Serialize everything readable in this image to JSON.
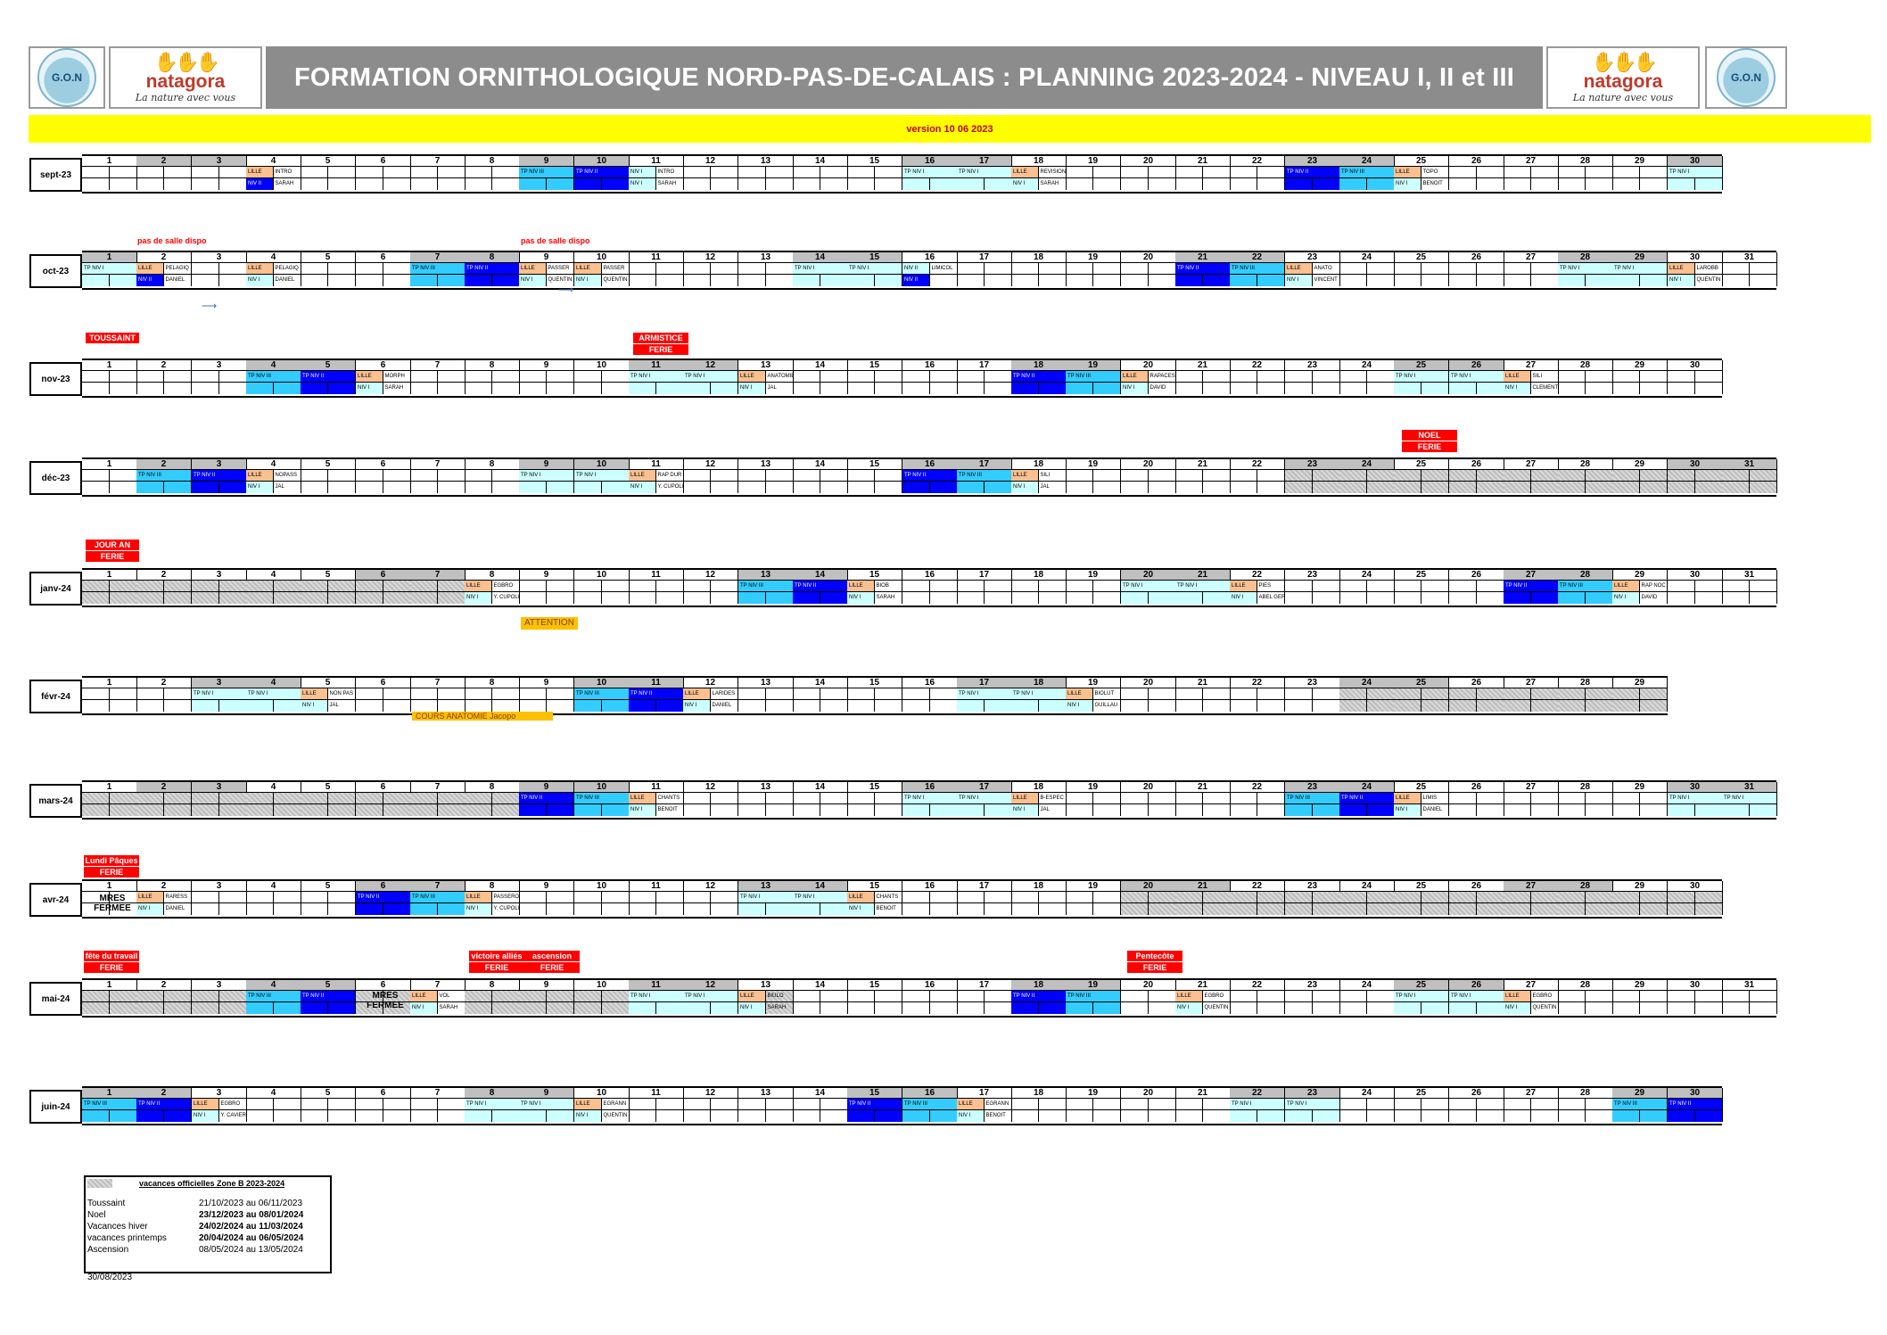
{
  "header": {
    "title": "FORMATION ORNITHOLOGIQUE NORD-PAS-DE-CALAIS : PLANNING 2023-2024 - NIVEAU I, II et III",
    "version": "version 10 06 2023",
    "logo_gon": "G.O.N",
    "logo_natagora": "natagora",
    "logo_tagline": "La nature avec vous"
  },
  "colors": {
    "tp_niv_1": "#ccffff",
    "tp_niv_2": "#0000ff",
    "tp_niv_3": "#33ccff",
    "lille": "#fac090",
    "ferie": "#ff0000",
    "version_bar": "#ffff00"
  },
  "months": [
    {
      "label": "sept-23",
      "days": 30,
      "weekends": [
        2,
        3,
        9,
        10,
        16,
        17,
        23,
        24,
        30
      ]
    },
    {
      "label": "oct-23",
      "days": 31,
      "weekends": [
        1,
        7,
        8,
        14,
        15,
        21,
        22,
        28,
        29
      ]
    },
    {
      "label": "nov-23",
      "days": 30,
      "weekends": [
        4,
        5,
        11,
        12,
        18,
        19,
        25,
        26
      ]
    },
    {
      "label": "déc-23",
      "days": 31,
      "weekends": [
        2,
        3,
        9,
        10,
        16,
        17,
        23,
        24,
        30,
        31
      ]
    },
    {
      "label": "janv-24",
      "days": 31,
      "weekends": [
        6,
        7,
        13,
        14,
        20,
        21,
        27,
        28
      ]
    },
    {
      "label": "févr-24",
      "days": 29,
      "weekends": [
        3,
        4,
        10,
        11,
        17,
        18,
        24,
        25
      ]
    },
    {
      "label": "mars-24",
      "days": 31,
      "weekends": [
        2,
        3,
        9,
        10,
        16,
        17,
        23,
        24,
        30,
        31
      ]
    },
    {
      "label": "avr-24",
      "days": 30,
      "weekends": [
        6,
        7,
        13,
        14,
        20,
        21,
        27,
        28
      ]
    },
    {
      "label": "mai-24",
      "days": 31,
      "weekends": [
        4,
        5,
        11,
        12,
        18,
        19,
        25,
        26
      ]
    },
    {
      "label": "juin-24",
      "days": 30,
      "weekends": [
        1,
        2,
        8,
        9,
        15,
        16,
        22,
        23,
        29,
        30
      ]
    }
  ],
  "texts": {
    "tp1": "TP NIV I",
    "tp2": "TP NIV II",
    "tp3": "TP NIV III",
    "lille": "LILLE",
    "niv1": "NIV I",
    "niv2": "NIV II",
    "ferie": "FERIE",
    "toussaint": "TOUSSAINT",
    "armistice": "ARMISTICE",
    "noel": "NOEL",
    "jour_an": "JOUR AN",
    "lundi_paques": "Lundi Pâques",
    "fete_travail": "fête du travail",
    "victoire": "victoire alliés",
    "ascension": "ascension",
    "pentecote": "Pentecôte",
    "pas_de_salle": "pas de salle dispo",
    "attention": "ATTENTION",
    "cours_anatomie": "COURS ANATOMIE Jacopo",
    "mres_fermee_1": "MRES",
    "mres_fermee_2": "FERMEE"
  },
  "legend": {
    "title": "vacances officielles  Zone B 2023-2024",
    "rows": [
      {
        "name": "Toussaint",
        "dates": "21/10/2023 au 06/11/2023"
      },
      {
        "name": "Noel",
        "dates": "23/12/2023 au 08/01/2024"
      },
      {
        "name": "Vacances hiver",
        "dates": "24/02/2024 au 11/03/2024"
      },
      {
        "name": "vacances printemps",
        "dates": "20/04/2024 au 06/05/2024"
      },
      {
        "name": "Ascension",
        "dates": "08/05/2024 au 13/05/2024"
      }
    ],
    "footer_date": "30/08/2023"
  },
  "sessions": [
    {
      "m": 0,
      "d": 4,
      "a": "LILLE",
      "b": "INTRO",
      "c": "NIV II",
      "e": "SARAH"
    },
    {
      "m": 0,
      "d": 11,
      "a": "NIV I",
      "b": "INTRO",
      "c": "NIV I",
      "e": "SARAH"
    },
    {
      "m": 0,
      "d": 18,
      "a": "LILLE",
      "b": "REVISION",
      "c": "NIV I",
      "e": "SARAH"
    },
    {
      "m": 0,
      "d": 25,
      "a": "LILLE",
      "b": "TOPO",
      "c": "NIV I",
      "e": "BENOIT"
    },
    {
      "m": 1,
      "d": 2,
      "a": "LILLE",
      "b": "PELAGIQ",
      "c": "NIV II",
      "e": "DANIEL"
    },
    {
      "m": 1,
      "d": 4,
      "a": "LILLE",
      "b": "PELAGIQ",
      "c": "NIV I",
      "e": "DANIEL"
    },
    {
      "m": 1,
      "d": 9,
      "a": "LILLE",
      "b": "PASSER",
      "c": "NIV I",
      "e": "QUENTIN"
    },
    {
      "m": 1,
      "d": 10,
      "a": "LILLE",
      "b": "PASSER",
      "c": "NIV I",
      "e": "QUENTIN"
    },
    {
      "m": 1,
      "d": 16,
      "a": "NIV II",
      "b": "LIMICOL",
      "c": "NIV II",
      "e": ""
    },
    {
      "m": 1,
      "d": 23,
      "a": "LILLE",
      "b": "ANATO",
      "c": "NIV I",
      "e": "VINCENT"
    },
    {
      "m": 1,
      "d": 30,
      "a": "LILLE",
      "b": "LAROBB",
      "c": "NIV I",
      "e": "QUENTIN"
    },
    {
      "m": 2,
      "d": 6,
      "a": "LILLE",
      "b": "MORPH",
      "c": "NIV I",
      "e": "SARAH"
    },
    {
      "m": 2,
      "d": 13,
      "a": "LILLE",
      "b": "ANATOMIE",
      "c": "NIV I",
      "e": "JAL"
    },
    {
      "m": 2,
      "d": 20,
      "a": "LILLE",
      "b": "RAPACES",
      "c": "NIV I",
      "e": "DAVID"
    },
    {
      "m": 2,
      "d": 27,
      "a": "LILLE",
      "b": "SILI",
      "c": "NIV I",
      "e": "CLEMENT"
    },
    {
      "m": 3,
      "d": 4,
      "a": "LILLE",
      "b": "NOPASS",
      "c": "NIV I",
      "e": "JAL"
    },
    {
      "m": 3,
      "d": 11,
      "a": "LILLE",
      "b": "RAP DUR",
      "c": "NIV I",
      "e": "Y. CUPOLI"
    },
    {
      "m": 3,
      "d": 18,
      "a": "LILLE",
      "b": "SILI",
      "c": "NIV I",
      "e": "JAL"
    },
    {
      "m": 4,
      "d": 8,
      "a": "LILLE",
      "b": "EGBRO",
      "c": "NIV I",
      "e": "Y. CUPOLI"
    },
    {
      "m": 4,
      "d": 15,
      "a": "LILLE",
      "b": "BIOB",
      "c": "NIV I",
      "e": "SARAH"
    },
    {
      "m": 4,
      "d": 22,
      "a": "LILLE",
      "b": "PIES",
      "c": "NIV I",
      "e": "ABEL GERARD"
    },
    {
      "m": 4,
      "d": 29,
      "a": "LILLE",
      "b": "RAP NOC",
      "c": "NIV I",
      "e": "DAVID"
    },
    {
      "m": 5,
      "d": 5,
      "a": "LILLE",
      "b": "NON PAS",
      "c": "NIV I",
      "e": "JAL"
    },
    {
      "m": 5,
      "d": 12,
      "a": "LILLE",
      "b": "LARIDES",
      "c": "NIV I",
      "e": "DANIEL"
    },
    {
      "m": 5,
      "d": 19,
      "a": "LILLE",
      "b": "BIOLUT",
      "c": "NIV I",
      "e": "GUILLAU"
    },
    {
      "m": 6,
      "d": 11,
      "a": "LILLE",
      "b": "CHANTS",
      "c": "NIV I",
      "e": "BENOIT"
    },
    {
      "m": 6,
      "d": 18,
      "a": "LILLE",
      "b": "B-ESPEC",
      "c": "NIV I",
      "e": "JAL"
    },
    {
      "m": 6,
      "d": 25,
      "a": "LILLE",
      "b": "LIMIS",
      "c": "NIV I",
      "e": "DANIEL"
    },
    {
      "m": 7,
      "d": 2,
      "a": "LILLE",
      "b": "RARESS",
      "c": "NIV I",
      "e": "DANIEL"
    },
    {
      "m": 7,
      "d": 8,
      "a": "LILLE",
      "b": "PASSERO",
      "c": "NIV I",
      "e": "Y. CUPOLI"
    },
    {
      "m": 7,
      "d": 15,
      "a": "LILLE",
      "b": "CHANTS",
      "c": "NIV I",
      "e": "BENOIT"
    },
    {
      "m": 8,
      "d": 7,
      "a": "LILLE",
      "b": "VOL",
      "c": "NIV I",
      "e": "SARAH"
    },
    {
      "m": 8,
      "d": 13,
      "a": "LILLE",
      "b": "BIULO",
      "c": "NIV I",
      "e": "SARAH"
    },
    {
      "m": 8,
      "d": 21,
      "a": "LILLE",
      "b": "EGBRO",
      "c": "NIV I",
      "e": "QUENTIN"
    },
    {
      "m": 8,
      "d": 27,
      "a": "LILLE",
      "b": "EGBRO",
      "c": "NIV I",
      "e": "QUENTIN"
    },
    {
      "m": 9,
      "d": 3,
      "a": "LILLE",
      "b": "EGBRO",
      "c": "NIV I",
      "e": "Y. CAVIER"
    },
    {
      "m": 9,
      "d": 10,
      "a": "LILLE",
      "b": "EGRANN",
      "c": "NIV I",
      "e": "QUENTIN"
    },
    {
      "m": 9,
      "d": 17,
      "a": "LILLE",
      "b": "EGRANN",
      "c": "NIV I",
      "e": "BENOIT"
    }
  ],
  "tp": [
    {
      "m": 0,
      "d": 9,
      "t": "tp3"
    },
    {
      "m": 0,
      "d": 10,
      "t": "tp2"
    },
    {
      "m": 0,
      "d": 16,
      "t": "tp1"
    },
    {
      "m": 0,
      "d": 17,
      "t": "tp1"
    },
    {
      "m": 0,
      "d": 23,
      "t": "tp2"
    },
    {
      "m": 0,
      "d": 24,
      "t": "tp3"
    },
    {
      "m": 0,
      "d": 30,
      "t": "tp1"
    },
    {
      "m": 1,
      "d": 1,
      "t": "tp1"
    },
    {
      "m": 1,
      "d": 7,
      "t": "tp3"
    },
    {
      "m": 1,
      "d": 8,
      "t": "tp2"
    },
    {
      "m": 1,
      "d": 14,
      "t": "tp1"
    },
    {
      "m": 1,
      "d": 15,
      "t": "tp1"
    },
    {
      "m": 1,
      "d": 21,
      "t": "tp2"
    },
    {
      "m": 1,
      "d": 22,
      "t": "tp3"
    },
    {
      "m": 1,
      "d": 28,
      "t": "tp1"
    },
    {
      "m": 1,
      "d": 29,
      "t": "tp1"
    },
    {
      "m": 2,
      "d": 4,
      "t": "tp3"
    },
    {
      "m": 2,
      "d": 5,
      "t": "tp2"
    },
    {
      "m": 2,
      "d": 11,
      "t": "tp1"
    },
    {
      "m": 2,
      "d": 12,
      "t": "tp1"
    },
    {
      "m": 2,
      "d": 18,
      "t": "tp2"
    },
    {
      "m": 2,
      "d": 19,
      "t": "tp3"
    },
    {
      "m": 2,
      "d": 25,
      "t": "tp1"
    },
    {
      "m": 2,
      "d": 26,
      "t": "tp1"
    },
    {
      "m": 3,
      "d": 2,
      "t": "tp3"
    },
    {
      "m": 3,
      "d": 3,
      "t": "tp2"
    },
    {
      "m": 3,
      "d": 9,
      "t": "tp1"
    },
    {
      "m": 3,
      "d": 10,
      "t": "tp1"
    },
    {
      "m": 3,
      "d": 16,
      "t": "tp2"
    },
    {
      "m": 3,
      "d": 17,
      "t": "tp3"
    },
    {
      "m": 4,
      "d": 13,
      "t": "tp3"
    },
    {
      "m": 4,
      "d": 14,
      "t": "tp2"
    },
    {
      "m": 4,
      "d": 20,
      "t": "tp1"
    },
    {
      "m": 4,
      "d": 21,
      "t": "tp1"
    },
    {
      "m": 4,
      "d": 27,
      "t": "tp2"
    },
    {
      "m": 4,
      "d": 28,
      "t": "tp3"
    },
    {
      "m": 5,
      "d": 3,
      "t": "tp1"
    },
    {
      "m": 5,
      "d": 4,
      "t": "tp1"
    },
    {
      "m": 5,
      "d": 10,
      "t": "tp3"
    },
    {
      "m": 5,
      "d": 11,
      "t": "tp2"
    },
    {
      "m": 5,
      "d": 17,
      "t": "tp1"
    },
    {
      "m": 5,
      "d": 18,
      "t": "tp1"
    },
    {
      "m": 6,
      "d": 9,
      "t": "tp2"
    },
    {
      "m": 6,
      "d": 10,
      "t": "tp3"
    },
    {
      "m": 6,
      "d": 16,
      "t": "tp1"
    },
    {
      "m": 6,
      "d": 17,
      "t": "tp1"
    },
    {
      "m": 6,
      "d": 23,
      "t": "tp3"
    },
    {
      "m": 6,
      "d": 24,
      "t": "tp2"
    },
    {
      "m": 6,
      "d": 30,
      "t": "tp1"
    },
    {
      "m": 6,
      "d": 31,
      "t": "tp1"
    },
    {
      "m": 7,
      "d": 6,
      "t": "tp2"
    },
    {
      "m": 7,
      "d": 7,
      "t": "tp3"
    },
    {
      "m": 7,
      "d": 13,
      "t": "tp1"
    },
    {
      "m": 7,
      "d": 14,
      "t": "tp1"
    },
    {
      "m": 8,
      "d": 4,
      "t": "tp3"
    },
    {
      "m": 8,
      "d": 5,
      "t": "tp2"
    },
    {
      "m": 8,
      "d": 11,
      "t": "tp1"
    },
    {
      "m": 8,
      "d": 12,
      "t": "tp1"
    },
    {
      "m": 8,
      "d": 18,
      "t": "tp2"
    },
    {
      "m": 8,
      "d": 19,
      "t": "tp3"
    },
    {
      "m": 8,
      "d": 25,
      "t": "tp1"
    },
    {
      "m": 8,
      "d": 26,
      "t": "tp1"
    },
    {
      "m": 9,
      "d": 1,
      "t": "tp3"
    },
    {
      "m": 9,
      "d": 2,
      "t": "tp2"
    },
    {
      "m": 9,
      "d": 8,
      "t": "tp1"
    },
    {
      "m": 9,
      "d": 9,
      "t": "tp1"
    },
    {
      "m": 9,
      "d": 15,
      "t": "tp2"
    },
    {
      "m": 9,
      "d": 16,
      "t": "tp3"
    },
    {
      "m": 9,
      "d": 22,
      "t": "tp1"
    },
    {
      "m": 9,
      "d": 23,
      "t": "tp1"
    },
    {
      "m": 9,
      "d": 29,
      "t": "tp3"
    },
    {
      "m": 9,
      "d": 30,
      "t": "tp2"
    }
  ]
}
